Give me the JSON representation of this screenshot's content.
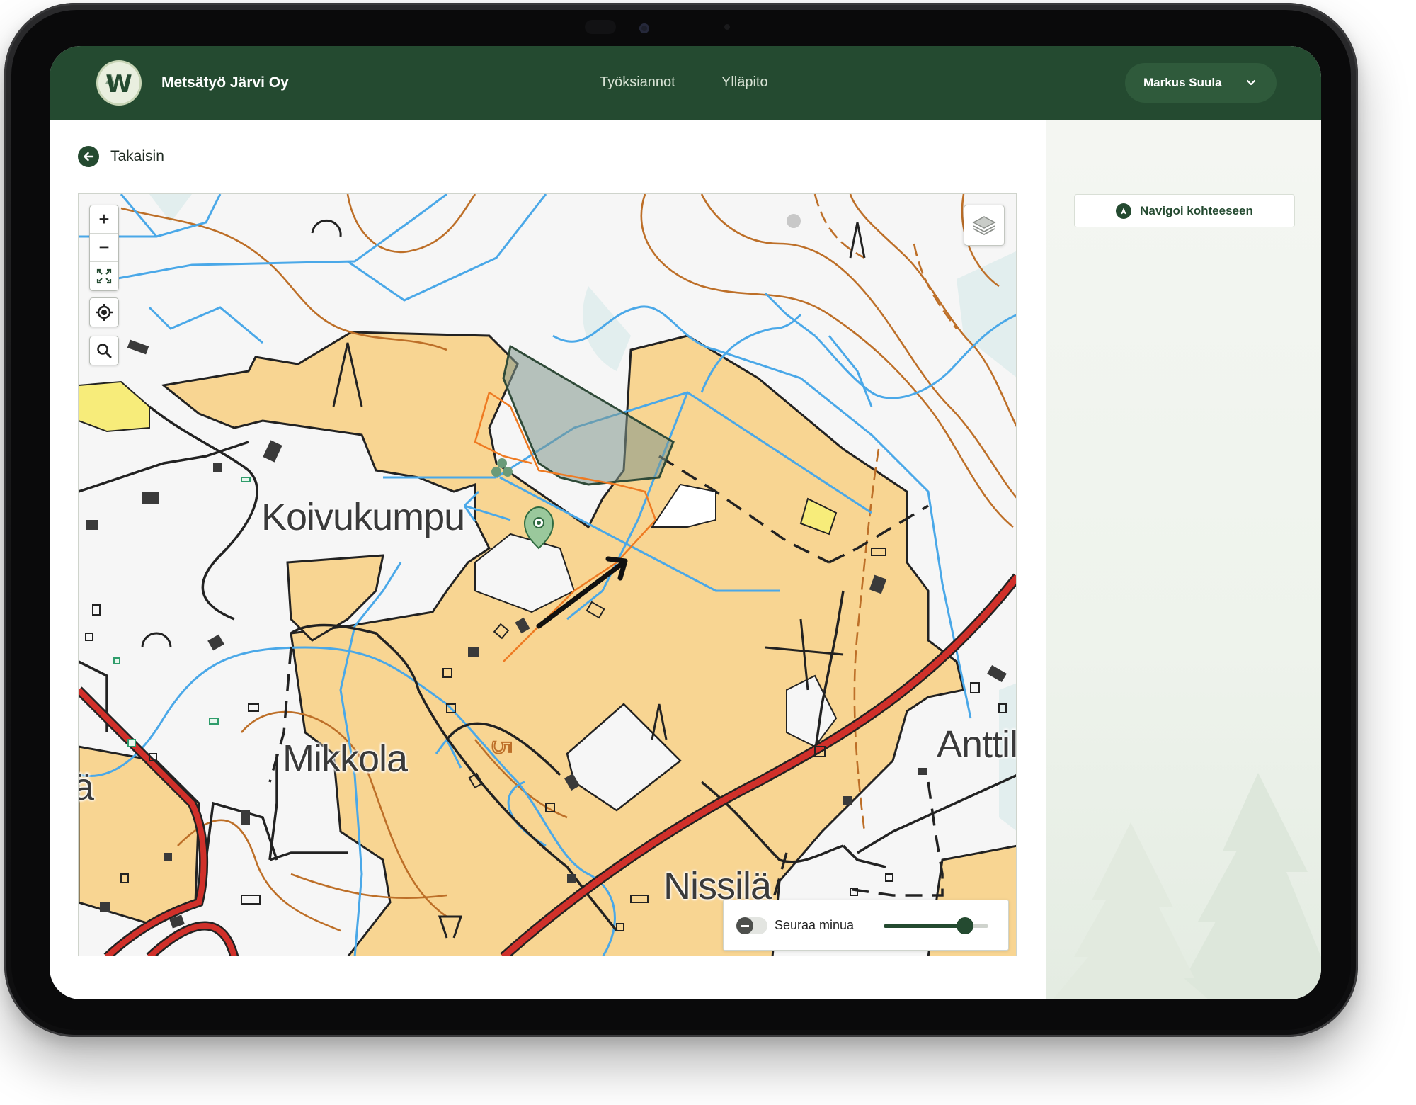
{
  "app": {
    "company_name": "Metsätyö Järvi Oy",
    "logo_letter": "W",
    "colors": {
      "brand_dark": "#244a30",
      "accent": "#2f5a3b"
    }
  },
  "header": {
    "nav": [
      {
        "label": "Työksiannot"
      },
      {
        "label": "Ylläpito"
      }
    ],
    "user": {
      "name": "Markus Suula"
    }
  },
  "page": {
    "back_label": "Takaisin",
    "navigate_button_label": "Navigoi kohteeseen"
  },
  "map": {
    "controls": {
      "zoom_in": "+",
      "zoom_out": "−"
    },
    "place_names": [
      {
        "id": "koivukumpu",
        "text": "Koivukumpu"
      },
      {
        "id": "mikkola",
        "text": "Mikkola"
      },
      {
        "id": "nissila",
        "text": "Nissilä"
      },
      {
        "id": "anttil",
        "text": "Anttil"
      },
      {
        "id": "edge",
        "text": "ä"
      }
    ],
    "road_number": "5",
    "follow": {
      "label": "Seuraa minua",
      "enabled": false,
      "zoom_level": 0.78
    }
  }
}
